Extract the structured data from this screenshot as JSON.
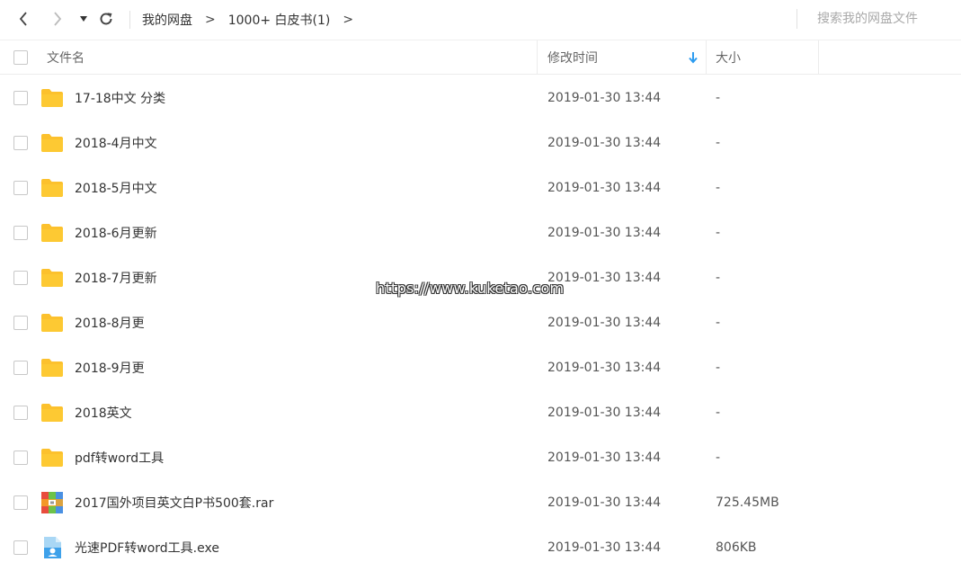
{
  "toolbar": {
    "breadcrumbs": [
      "我的网盘",
      "1000+ 白皮书(1)"
    ],
    "search_placeholder": "搜索我的网盘文件"
  },
  "header": {
    "name": "文件名",
    "modified": "修改时间",
    "size": "大小"
  },
  "files": [
    {
      "name": "17-18中文 分类",
      "time": "2019-01-30 13:44",
      "size": "-",
      "icon": "folder-icon"
    },
    {
      "name": "2018-4月中文",
      "time": "2019-01-30 13:44",
      "size": "-",
      "icon": "folder-icon"
    },
    {
      "name": "2018-5月中文",
      "time": "2019-01-30 13:44",
      "size": "-",
      "icon": "folder-icon"
    },
    {
      "name": "2018-6月更新",
      "time": "2019-01-30 13:44",
      "size": "-",
      "icon": "folder-icon"
    },
    {
      "name": "2018-7月更新",
      "time": "2019-01-30 13:44",
      "size": "-",
      "icon": "folder-icon"
    },
    {
      "name": "2018-8月更",
      "time": "2019-01-30 13:44",
      "size": "-",
      "icon": "folder-icon"
    },
    {
      "name": "2018-9月更",
      "time": "2019-01-30 13:44",
      "size": "-",
      "icon": "folder-icon"
    },
    {
      "name": "2018英文",
      "time": "2019-01-30 13:44",
      "size": "-",
      "icon": "folder-icon"
    },
    {
      "name": "pdf转word工具",
      "time": "2019-01-30 13:44",
      "size": "-",
      "icon": "folder-icon"
    },
    {
      "name": "2017国外项目英文白P书500套.rar",
      "time": "2019-01-30 13:44",
      "size": "725.45MB",
      "icon": "rar-archive-icon"
    },
    {
      "name": "光速PDF转word工具.exe",
      "time": "2019-01-30 13:44",
      "size": "806KB",
      "icon": "exe-file-icon"
    }
  ],
  "watermark": "https://www.kuketao.com",
  "colors": {
    "folder": "#fcc12d",
    "sort_arrow": "#2d9cf0"
  }
}
